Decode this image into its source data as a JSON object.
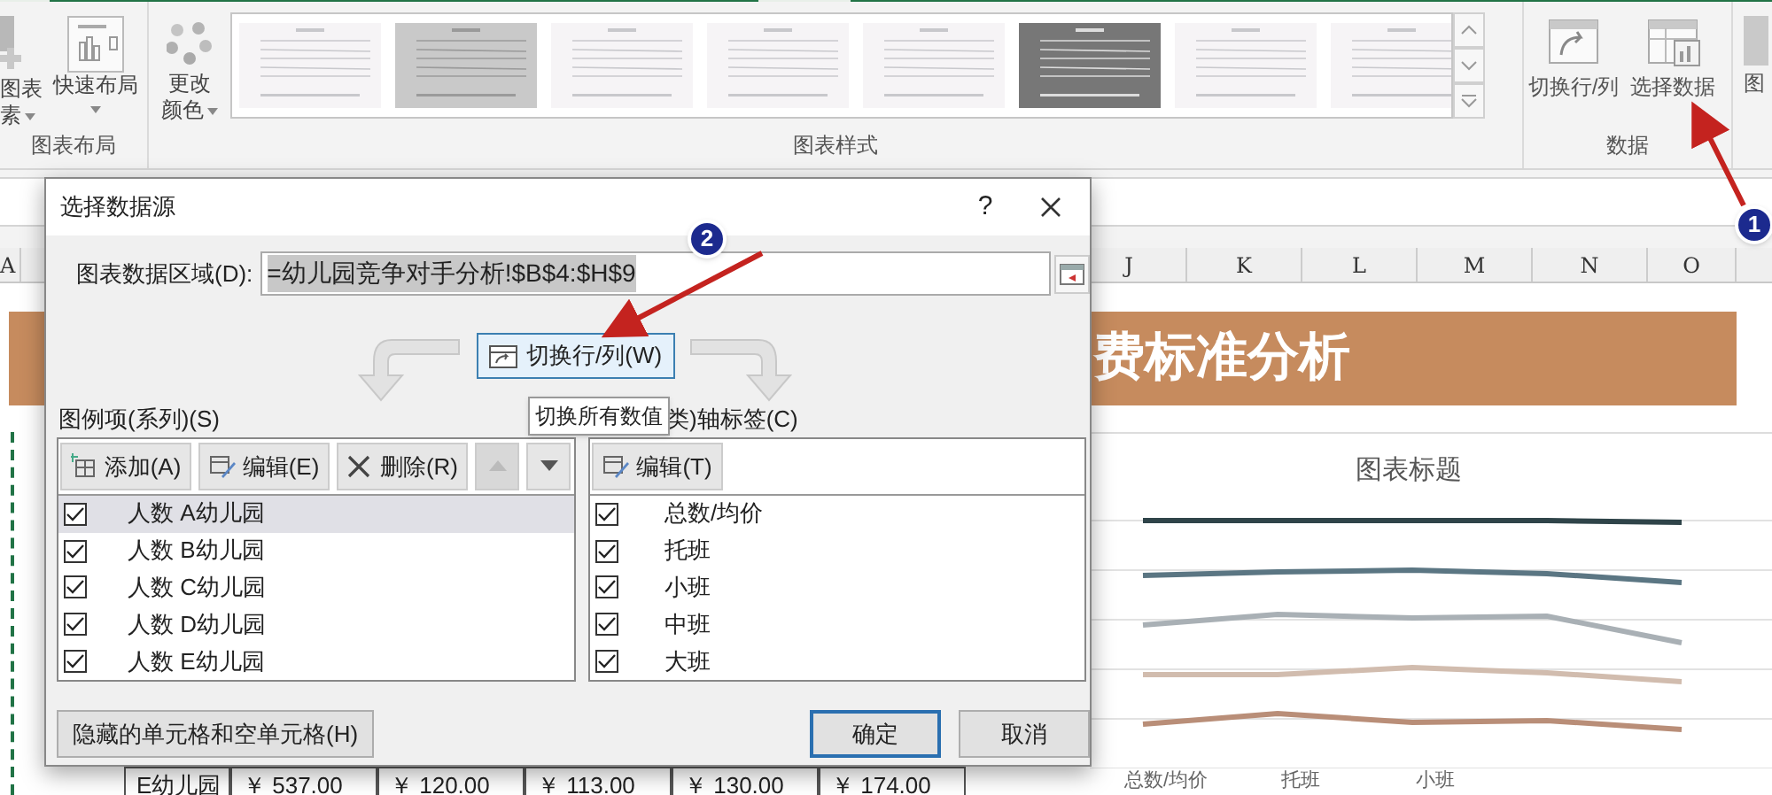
{
  "ribbon": {
    "chart_elements": {
      "label_lines": [
        "图表",
        "素"
      ]
    },
    "quick_layout": {
      "label": "快速布局"
    },
    "change_colors": {
      "label_lines": [
        "更改",
        "颜色"
      ]
    },
    "chart_styles": [
      {
        "kind": "light"
      },
      {
        "kind": "grey"
      },
      {
        "kind": "light"
      },
      {
        "kind": "light"
      },
      {
        "kind": "light"
      },
      {
        "kind": "dark"
      },
      {
        "kind": "light"
      },
      {
        "kind": "light"
      }
    ],
    "data_buttons": [
      {
        "kind": "switch",
        "label": "切换行/列"
      },
      {
        "kind": "select",
        "label": "选择数据"
      }
    ],
    "cut_label": "图",
    "groups": [
      "图表布局",
      "图表样式",
      "数据"
    ]
  },
  "sheet": {
    "left_columns": [
      "A"
    ],
    "columns": [
      "J",
      "K",
      "L",
      "M",
      "N",
      "O"
    ],
    "banner_title": "费标准分析",
    "chart": {
      "title": "图表标题",
      "categories": [
        "总数/均价",
        "托班",
        "小班"
      ],
      "lines": [
        {
          "color": "#2f4449"
        },
        {
          "color": "#5b7683"
        },
        {
          "color": "#a9b0b5"
        },
        {
          "color": "#d1bcae"
        },
        {
          "color": "#b98e78"
        }
      ]
    },
    "table_row": [
      "E幼儿园",
      "￥ 537.00",
      "￥ 120.00",
      "￥ 113.00",
      "￥ 130.00",
      "￥ 174.00"
    ]
  },
  "dialog": {
    "title": "选择数据源",
    "help": "?",
    "range_label": "图表数据区域(D):",
    "range_value": "=幼儿园竞争对手分析!$B$4:$H$9",
    "switch_button": "切换行/列(W)",
    "tooltip": "切换所有数值",
    "series_label": "图例项(系列)(S)",
    "axis_label": "类)轴标签(C)",
    "series_buttons": [
      {
        "kind": "add",
        "label": "添加(A)",
        "disabled": false
      },
      {
        "kind": "edit",
        "label": "编辑(E)",
        "disabled": false
      },
      {
        "kind": "delete",
        "label": "删除(R)",
        "disabled": false
      },
      {
        "kind": "up",
        "disabled": true
      },
      {
        "kind": "down",
        "disabled": false
      }
    ],
    "axis_button": "编辑(T)",
    "series": [
      {
        "label": "人数 A幼儿园",
        "checked": true,
        "selected": true
      },
      {
        "label": "人数 B幼儿园",
        "checked": true,
        "selected": false
      },
      {
        "label": "人数 C幼儿园",
        "checked": true,
        "selected": false
      },
      {
        "label": "人数 D幼儿园",
        "checked": true,
        "selected": false
      },
      {
        "label": "人数 E幼儿园",
        "checked": true,
        "selected": false
      }
    ],
    "categories": [
      {
        "label": "总数/均价",
        "checked": true
      },
      {
        "label": "托班",
        "checked": true
      },
      {
        "label": "小班",
        "checked": true
      },
      {
        "label": "中班",
        "checked": true
      },
      {
        "label": "大班",
        "checked": true
      }
    ],
    "hidden_cells_button": "隐藏的单元格和空单元格(H)",
    "buttons": [
      {
        "label": "确定",
        "focused": true
      },
      {
        "label": "取消",
        "focused": false
      }
    ]
  },
  "annotations": [
    {
      "number": "1"
    },
    {
      "number": "2"
    }
  ]
}
